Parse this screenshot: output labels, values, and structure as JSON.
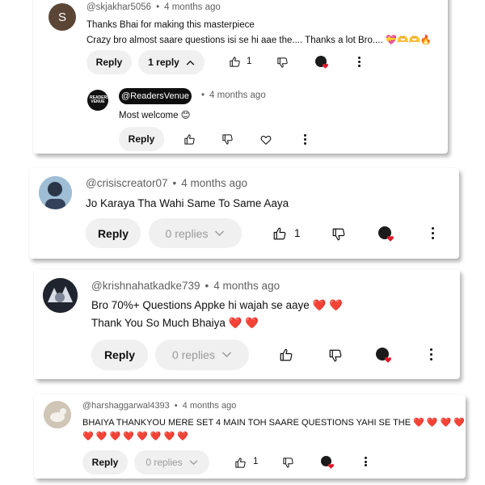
{
  "comments": [
    {
      "avatar_letter": "S",
      "avatar_color": "#5b4636",
      "handle": "@skjakhar5056",
      "time": "4 months ago",
      "lines": [
        "Thanks Bhai for making this masterpiece",
        "Crazy bro almost saare questions isi se hi aae the.... Thanks a lot Bro.... 💝🫶🫶🔥"
      ],
      "reply_label": "Reply",
      "replies_label": "1 reply",
      "likes": "1",
      "reply_item": {
        "handle": "@ReadersVenue",
        "time": "4 months ago",
        "text": "Most welcome 😊",
        "reply_label": "Reply",
        "logo_text": "READERS VENUE"
      }
    },
    {
      "handle": "@crisiscreator07",
      "time": "4 months ago",
      "lines": [
        "Jo Karaya Tha Wahi Same To Same Aaya"
      ],
      "reply_label": "Reply",
      "replies_label": "0 replies",
      "likes": "1"
    },
    {
      "handle": "@krishnahatkadke739",
      "time": "4 months ago",
      "lines": [
        "Bro 70%+ Questions Appke hi wajah se aaye ❤️ ❤️",
        "Thank You So Much Bhaiya ❤️ ❤️"
      ],
      "reply_label": "Reply",
      "replies_label": "0 replies",
      "likes": ""
    },
    {
      "handle": "@harshaggarwal4393",
      "time": "4 months ago",
      "lines": [
        "BHAIYA THANKYOU MERE SET 4 MAIN TOH SAARE QUESTIONS YAHI SE THE ❤️ ❤️ ❤️ ❤️",
        "❤️ ❤️ ❤️ ❤️ ❤️ ❤️ ❤️ ❤️"
      ],
      "reply_label": "Reply",
      "replies_label": "0 replies",
      "likes": "1"
    }
  ],
  "colors": {
    "accent_heart": "#e0192b",
    "pill_bg": "#f0f0f0",
    "muted": "#606060"
  }
}
